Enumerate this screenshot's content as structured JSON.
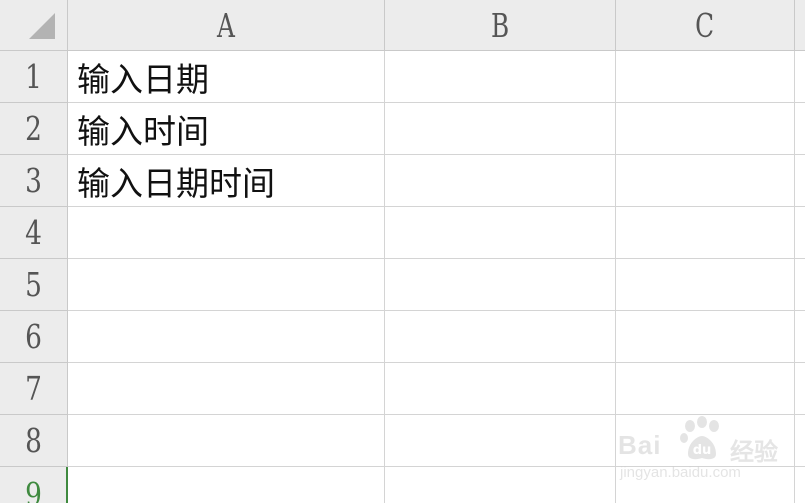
{
  "columns": [
    "A",
    "B",
    "C"
  ],
  "rows": [
    "1",
    "2",
    "3",
    "4",
    "5",
    "6",
    "7",
    "8",
    "9"
  ],
  "cells": {
    "A1": "输入日期",
    "A2": "输入时间",
    "A3": "输入日期时间"
  },
  "active_row": "9",
  "accent_color": "#3f8a3f",
  "watermark": {
    "logo": "Bai 百 经验",
    "url": "jingyan.baidu.com"
  },
  "icons": [
    "select-all-triangle-icon",
    "baidu-paw-icon"
  ]
}
